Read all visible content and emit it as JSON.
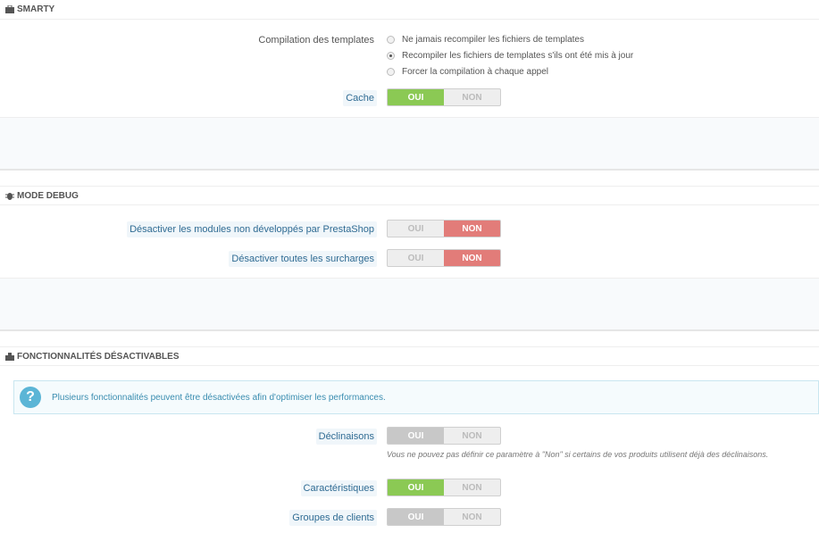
{
  "smarty": {
    "title": "SMARTY",
    "icon": "briefcase-icon",
    "compilation_label": "Compilation des templates",
    "options": [
      {
        "label": "Ne jamais recompiler les fichiers de templates",
        "checked": false
      },
      {
        "label": "Recompiler les fichiers de templates s'ils ont été mis à jour",
        "checked": true
      },
      {
        "label": "Forcer la compilation à chaque appel",
        "checked": false
      }
    ],
    "cache_label": "Cache",
    "cache_on": "OUI",
    "cache_off": "NON",
    "cache_value": "OUI"
  },
  "debug": {
    "title": "MODE DEBUG",
    "icon": "bug-icon",
    "disable_modules_label": "Désactiver les modules non développés par PrestaShop",
    "disable_modules_on": "OUI",
    "disable_modules_off": "NON",
    "disable_modules_value": "NON",
    "disable_overrides_label": "Désactiver toutes les surcharges",
    "disable_overrides_on": "OUI",
    "disable_overrides_off": "NON",
    "disable_overrides_value": "NON"
  },
  "features": {
    "title": "FONCTIONNALITÉS DÉSACTIVABLES",
    "icon": "puzzle-icon",
    "alert_icon": "question-icon",
    "alert_text": "Plusieurs fonctionnalités peuvent être désactivées afin d'optimiser les performances.",
    "combinations_label": "Déclinaisons",
    "combinations_on": "OUI",
    "combinations_off": "NON",
    "combinations_value": "OUI",
    "combinations_help": "Vous ne pouvez pas définir ce paramètre à \"Non\" si certains de vos produits utilisent déjà des déclinaisons.",
    "characteristics_label": "Caractéristiques",
    "characteristics_on": "OUI",
    "characteristics_off": "NON",
    "characteristics_value": "OUI",
    "groups_label": "Groupes de clients",
    "groups_on": "OUI",
    "groups_off": "NON",
    "groups_value": "OUI"
  },
  "colors": {
    "switch_on_green": "#8bc954",
    "switch_on_red": "#e27c79",
    "switch_disabled": "#c8c8c8",
    "label_hint_text": "#2f6b93",
    "alert_blue": "#5bb5d6"
  }
}
